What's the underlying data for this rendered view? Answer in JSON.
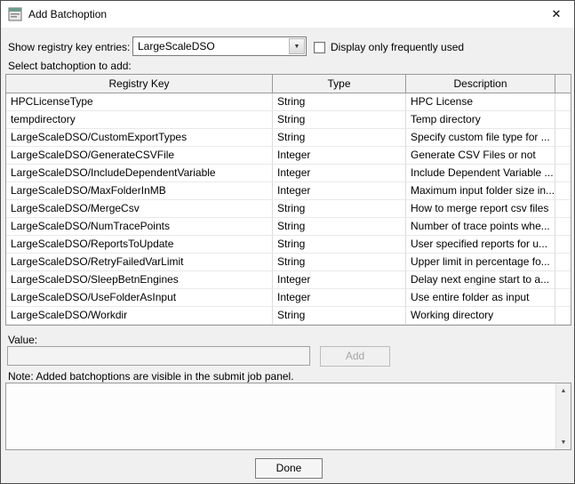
{
  "window": {
    "title": "Add Batchoption"
  },
  "icons": {
    "close": "✕",
    "dropdown_arrow": "▼",
    "scroll_up": "▲",
    "scroll_down": "▼"
  },
  "filters": {
    "registry_label": "Show registry key entries:",
    "registry_selected": "LargeScaleDSO",
    "frequent_label": "Display only frequently used",
    "frequent_checked": false
  },
  "select_label": "Select batchoption to add:",
  "table": {
    "headers": [
      "Registry Key",
      "Type",
      "Description"
    ],
    "rows": [
      {
        "key": "HPCLicenseType",
        "type": "String",
        "desc": "HPC License"
      },
      {
        "key": "tempdirectory",
        "type": "String",
        "desc": "Temp directory"
      },
      {
        "key": "LargeScaleDSO/CustomExportTypes",
        "type": "String",
        "desc": "Specify custom file type for ..."
      },
      {
        "key": "LargeScaleDSO/GenerateCSVFile",
        "type": "Integer",
        "desc": "Generate CSV Files or not"
      },
      {
        "key": "LargeScaleDSO/IncludeDependentVariable",
        "type": "Integer",
        "desc": "Include Dependent Variable ..."
      },
      {
        "key": "LargeScaleDSO/MaxFolderInMB",
        "type": "Integer",
        "desc": "Maximum input folder size in..."
      },
      {
        "key": "LargeScaleDSO/MergeCsv",
        "type": "String",
        "desc": "How to merge report csv files"
      },
      {
        "key": "LargeScaleDSO/NumTracePoints",
        "type": "String",
        "desc": "Number of trace points whe..."
      },
      {
        "key": "LargeScaleDSO/ReportsToUpdate",
        "type": "String",
        "desc": "User specified reports for u..."
      },
      {
        "key": "LargeScaleDSO/RetryFailedVarLimit",
        "type": "String",
        "desc": "Upper limit in percentage fo..."
      },
      {
        "key": "LargeScaleDSO/SleepBetnEngines",
        "type": "Integer",
        "desc": "Delay next engine start to a..."
      },
      {
        "key": "LargeScaleDSO/UseFolderAsInput",
        "type": "Integer",
        "desc": "Use entire folder as input"
      },
      {
        "key": "LargeScaleDSO/Workdir",
        "type": "String",
        "desc": "Working directory"
      }
    ]
  },
  "value_section": {
    "label": "Value:",
    "input_value": "",
    "add_button": "Add"
  },
  "note": {
    "label": "Note: Added batchoptions are visible in the submit job panel.",
    "content": ""
  },
  "footer": {
    "done_button": "Done"
  }
}
